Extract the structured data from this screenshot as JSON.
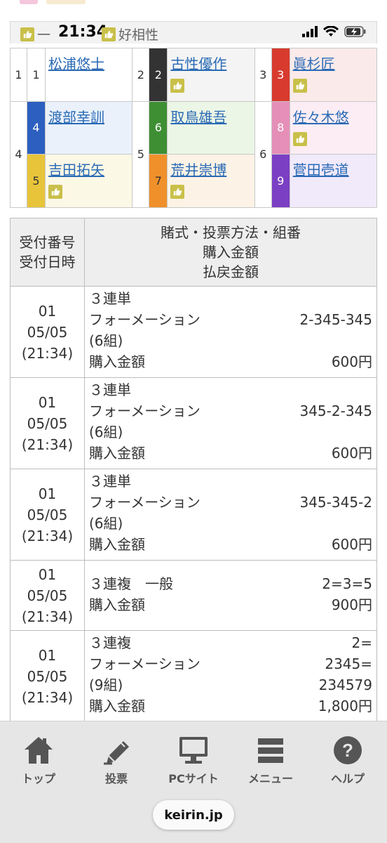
{
  "status": {
    "time": "21:34",
    "icons": [
      "signal-icon",
      "wifi-icon",
      "battery-charging-icon"
    ]
  },
  "legend": {
    "item1": "一",
    "item2": "好相性"
  },
  "lineup": {
    "lane1": "1",
    "lane2": "2",
    "lane3": "3",
    "lane4": "4",
    "lane5": "5",
    "lane6": "6",
    "riders": [
      {
        "num": "1",
        "name": "松浦悠士",
        "color": "#ffffff",
        "text": "#333333",
        "good": false
      },
      {
        "num": "2",
        "name": "古性優作",
        "color": "#333333",
        "text": "#ffffff",
        "good": true
      },
      {
        "num": "3",
        "name": "眞杉匠",
        "color": "#d83a2e",
        "text": "#ffffff",
        "good": true
      },
      {
        "num": "4",
        "name": "渡部幸訓",
        "color": "#2c5fbf",
        "text": "#ffffff",
        "good": false
      },
      {
        "num": "5",
        "name": "吉田拓矢",
        "color": "#e8c43a",
        "text": "#333333",
        "good": true
      },
      {
        "num": "6",
        "name": "取鳥雄吾",
        "color": "#3e8f33",
        "text": "#ffffff",
        "good": false
      },
      {
        "num": "7",
        "name": "荒井崇博",
        "color": "#f0902a",
        "text": "#333333",
        "good": true
      },
      {
        "num": "8",
        "name": "佐々木悠",
        "color": "#e58fb8",
        "text": "#ffffff",
        "good": true
      },
      {
        "num": "9",
        "name": "菅田壱道",
        "color": "#7b3fc4",
        "text": "#ffffff",
        "good": false
      }
    ]
  },
  "bets": {
    "header": {
      "col1_line1": "受付番号",
      "col1_line2": "受付日時",
      "col2_line1": "賭式・投票方法・組番",
      "col2_line2": "購入金額",
      "col2_line3": "払戻金額"
    },
    "rows": [
      {
        "no": "01",
        "date": "05/05",
        "time": "(21:34)",
        "type": "３連単",
        "method": "フォーメーション",
        "combo": "2-345-345",
        "sets": "(6組)",
        "amount_label": "購入金額",
        "amount": "600円"
      },
      {
        "no": "01",
        "date": "05/05",
        "time": "(21:34)",
        "type": "３連単",
        "method": "フォーメーション",
        "combo": "345-2-345",
        "sets": "(6組)",
        "amount_label": "購入金額",
        "amount": "600円"
      },
      {
        "no": "01",
        "date": "05/05",
        "time": "(21:34)",
        "type": "３連単",
        "method": "フォーメーション",
        "combo": "345-345-2",
        "sets": "(6組)",
        "amount_label": "購入金額",
        "amount": "600円"
      },
      {
        "no": "01",
        "date": "05/05",
        "time": "(21:34)",
        "type": "３連複　一般",
        "combo": "2=3=5",
        "amount_label": "購入金額",
        "amount": "900円"
      },
      {
        "no": "01",
        "date": "05/05",
        "time": "(21:34)",
        "type": "３連複",
        "combo1": "2=",
        "method": "フォーメーション",
        "combo2": "2345=",
        "sets": "(9組)",
        "combo3": "234579",
        "amount_label": "購入金額",
        "amount": "1,800円"
      }
    ]
  },
  "nav": {
    "top": "トップ",
    "vote": "投票",
    "pc": "PCサイト",
    "menu": "メニュー",
    "help": "ヘルプ"
  },
  "url": "keirin.jp"
}
